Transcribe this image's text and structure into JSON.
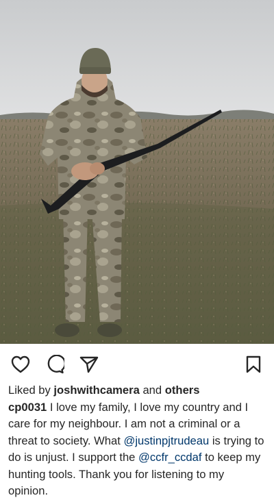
{
  "post": {
    "image_alt": "Hunter in camouflage holding a shotgun in a field",
    "icons": {
      "like": "heart-icon",
      "comment": "comment-icon",
      "share": "send-icon",
      "save": "bookmark-icon"
    },
    "likes": {
      "prefix": "Liked by ",
      "user": "joshwithcamera",
      "middle": " and ",
      "others": "others"
    },
    "caption": {
      "username": "cp0031",
      "text_1": " I love my family, I love my country and I care for my neighbour. I am not a criminal or a threat to society. What ",
      "mention_1": "@justinpjtrudeau",
      "text_2": " is trying to do is unjust. I support the ",
      "mention_2": "@ccfr_ccdaf",
      "text_3": " to keep my hunting tools. Thank you for listening to my opinion."
    }
  },
  "colors": {
    "text": "#262626",
    "mention": "#00376b",
    "background": "#ffffff"
  }
}
